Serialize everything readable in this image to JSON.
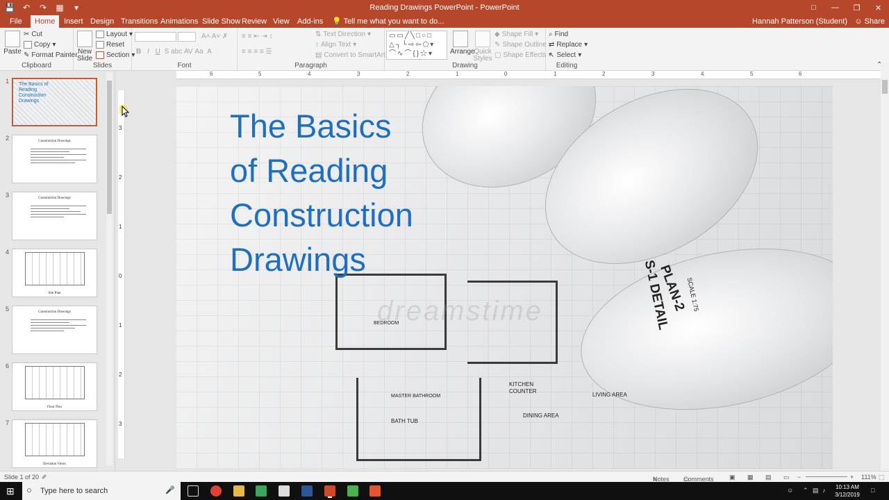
{
  "titlebar": {
    "title": "Reading Drawings PowerPoint - PowerPoint"
  },
  "tabs": [
    "File",
    "Home",
    "Insert",
    "Design",
    "Transitions",
    "Animations",
    "Slide Show",
    "Review",
    "View",
    "Add-ins"
  ],
  "tell_me": "Tell me what you want to do...",
  "user": "Hannah Patterson (Student)",
  "share": "Share",
  "ribbon": {
    "clipboard": {
      "label": "Clipboard",
      "paste": "Paste",
      "cut": "Cut",
      "copy": "Copy",
      "format_painter": "Format Painter"
    },
    "slides": {
      "label": "Slides",
      "new_slide": "New Slide",
      "layout": "Layout",
      "reset": "Reset",
      "section": "Section"
    },
    "font": {
      "label": "Font"
    },
    "paragraph": {
      "label": "Paragraph",
      "text_direction": "Text Direction",
      "align_text": "Align Text",
      "convert": "Convert to SmartArt"
    },
    "drawing": {
      "label": "Drawing",
      "arrange": "Arrange",
      "quick_styles": "Quick Styles",
      "shape_fill": "Shape Fill",
      "shape_outline": "Shape Outline",
      "shape_effects": "Shape Effects"
    },
    "editing": {
      "label": "Editing",
      "find": "Find",
      "replace": "Replace",
      "select": "Select"
    }
  },
  "ruler_marks": [
    "6",
    "5",
    "4",
    "3",
    "2",
    "1",
    "0",
    "1",
    "2",
    "3",
    "4",
    "5",
    "6"
  ],
  "vruler_marks": [
    "3",
    "2",
    "1",
    "0",
    "1",
    "2",
    "3"
  ],
  "thumbnails": [
    {
      "num": "1",
      "title": "The Basics of Reading Construction Drawings"
    },
    {
      "num": "2",
      "title": "Construction Drawings"
    },
    {
      "num": "3",
      "title": "Construction Drawings"
    },
    {
      "num": "4",
      "caption": "Site Plan"
    },
    {
      "num": "5",
      "title": "Construction Drawings"
    },
    {
      "num": "6",
      "caption": "Floor Plan"
    },
    {
      "num": "7",
      "caption": "Elevation Views"
    }
  ],
  "slide": {
    "title_lines": [
      "The Basics",
      "of Reading",
      "Construction",
      "Drawings"
    ],
    "photo_text": [
      "PLAN-2",
      "S-1 DETAIL",
      "SCALE 1:75",
      "KITCHEN",
      "COUNTER",
      "MASTER BATHROOM",
      "BATH TUB",
      "LIVING AREA",
      "DINING AREA",
      "BEDROOM"
    ],
    "watermark": "dreamstime"
  },
  "status": {
    "slide_of": "Slide 1 of 20",
    "notes": "Notes",
    "comments": "Comments",
    "zoom": "111%"
  },
  "taskbar": {
    "search": "Type here to search",
    "time": "10:13 AM",
    "date": "3/12/2019"
  }
}
